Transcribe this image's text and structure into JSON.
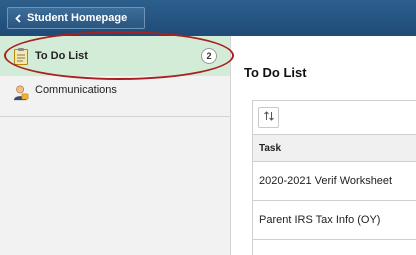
{
  "header": {
    "back_button_label": "Student Homepage",
    "colors": {
      "bar": "#2d5f8d"
    }
  },
  "sidebar": {
    "items": [
      {
        "label": "To Do List",
        "icon": "clipboard-icon",
        "badge": "2",
        "selected": true
      },
      {
        "label": "Communications",
        "icon": "person-icon",
        "selected": false
      }
    ],
    "colors": {
      "selected_bg": "#d3ecd8",
      "highlight_oval": "#a82020"
    }
  },
  "main": {
    "title": "To Do List",
    "grid": {
      "sort_icon": "sort-icon",
      "columns": [
        "Task"
      ],
      "rows": [
        [
          "2020-2021 Verif Worksheet"
        ],
        [
          "Parent IRS Tax Info (OY)"
        ]
      ]
    }
  }
}
